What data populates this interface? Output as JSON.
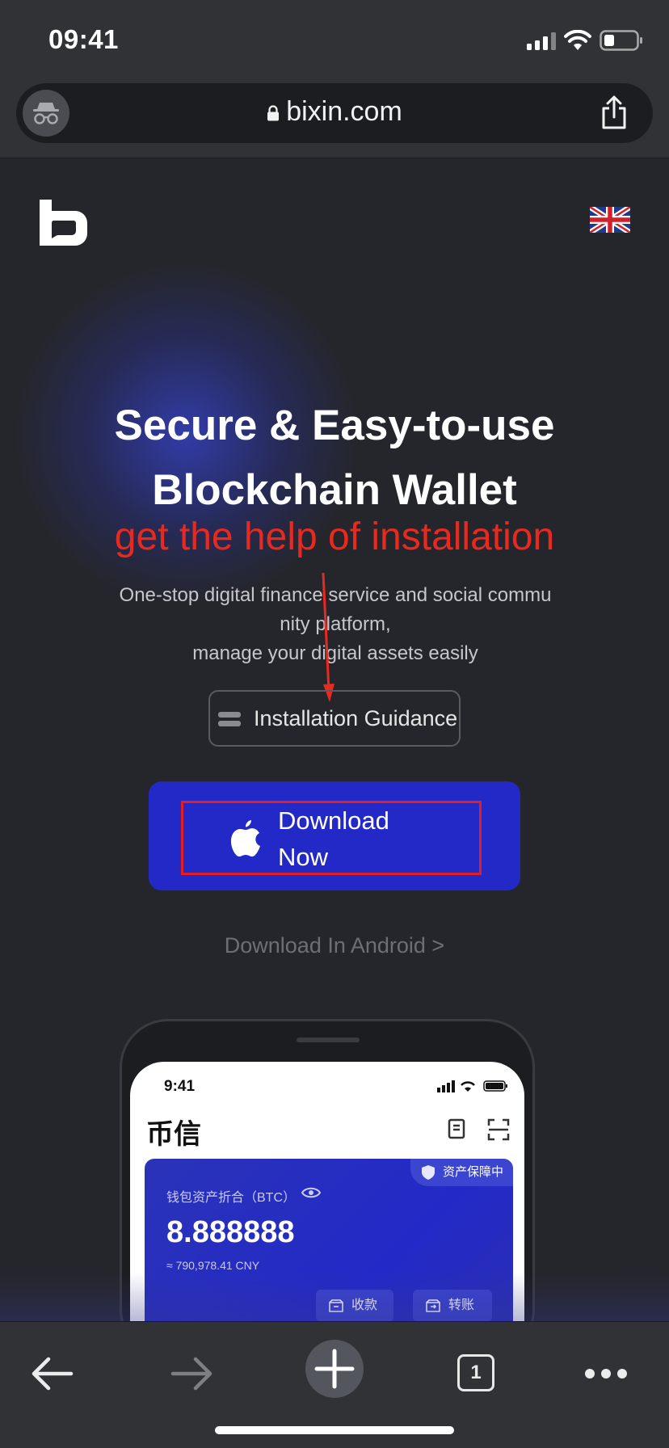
{
  "status_bar": {
    "time": "09:41",
    "icons": [
      "signal-icon",
      "wifi-icon",
      "battery-icon"
    ]
  },
  "url_bar": {
    "domain": "bixin.com",
    "left_icon": "incognito-icon",
    "right_icon": "share-icon"
  },
  "hero": {
    "headline_line1": "Secure & Easy-to-use",
    "headline_line2": "Blockchain Wallet",
    "annotation_text": "get the help of installation",
    "subtitle_line1": "One-stop digital finance service and social commu",
    "subtitle_line2": "nity platform,",
    "subtitle_line3": "manage your digital assets easily"
  },
  "buttons": {
    "installation_guidance": "Installation Guidance",
    "download_line1": "Download",
    "download_line2": "Now",
    "android_link": "Download In Android >"
  },
  "phone_mockup": {
    "time": "9:41",
    "app_name": "币信",
    "asset_badge": "资产保障中",
    "asset_label": "钱包资产折合（BTC）",
    "asset_amount": "8.888888",
    "asset_cny": "≈ 790,978.41 CNY",
    "receive_label": "收款",
    "transfer_label": "转账"
  },
  "toolbar": {
    "tab_count": "1",
    "icons": [
      "back-arrow-icon",
      "forward-arrow-icon",
      "plus-icon",
      "tabs-icon",
      "more-icon"
    ]
  },
  "colors": {
    "page_background": "#25262b",
    "browser_chrome": "#303236",
    "primary_button": "#2329c7",
    "annotation_red": "#e8291f",
    "muted_text": "#6e6f75"
  }
}
